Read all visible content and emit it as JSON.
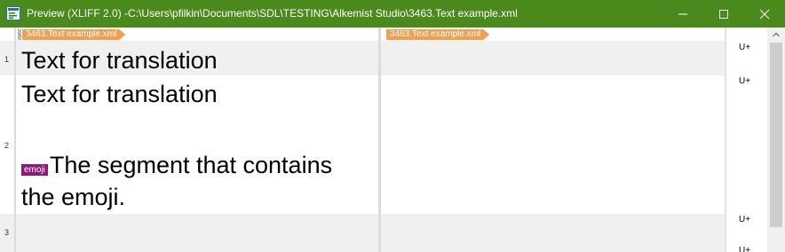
{
  "window": {
    "title": "Preview (XLIFF 2.0) -C:\\Users\\pfilkin\\Documents\\SDL\\TESTING\\Alkemist Studio\\3463.Text example.xml",
    "title_bar_color": "#4a8a1c",
    "icons": [
      "app-preview-icon",
      "minimize-icon",
      "maximize-icon",
      "close-icon"
    ]
  },
  "file_tags": {
    "source": "3463.Text example.xml",
    "target": "3463.Text example.xml",
    "color": "#f0a050"
  },
  "segments": [
    {
      "number": "1",
      "source_lines": [
        "Text for translation"
      ],
      "marker": "U+"
    },
    {
      "number": "2",
      "source_lines": [
        "Text for translation",
        "The segment that contains",
        "the emoji."
      ],
      "inline_tag": "emoji",
      "inline_tag_color": "#8a1a7e",
      "marker": "U+"
    },
    {
      "number": "3",
      "source_lines": [],
      "marker": "U+"
    }
  ],
  "extra_marker": "U+"
}
